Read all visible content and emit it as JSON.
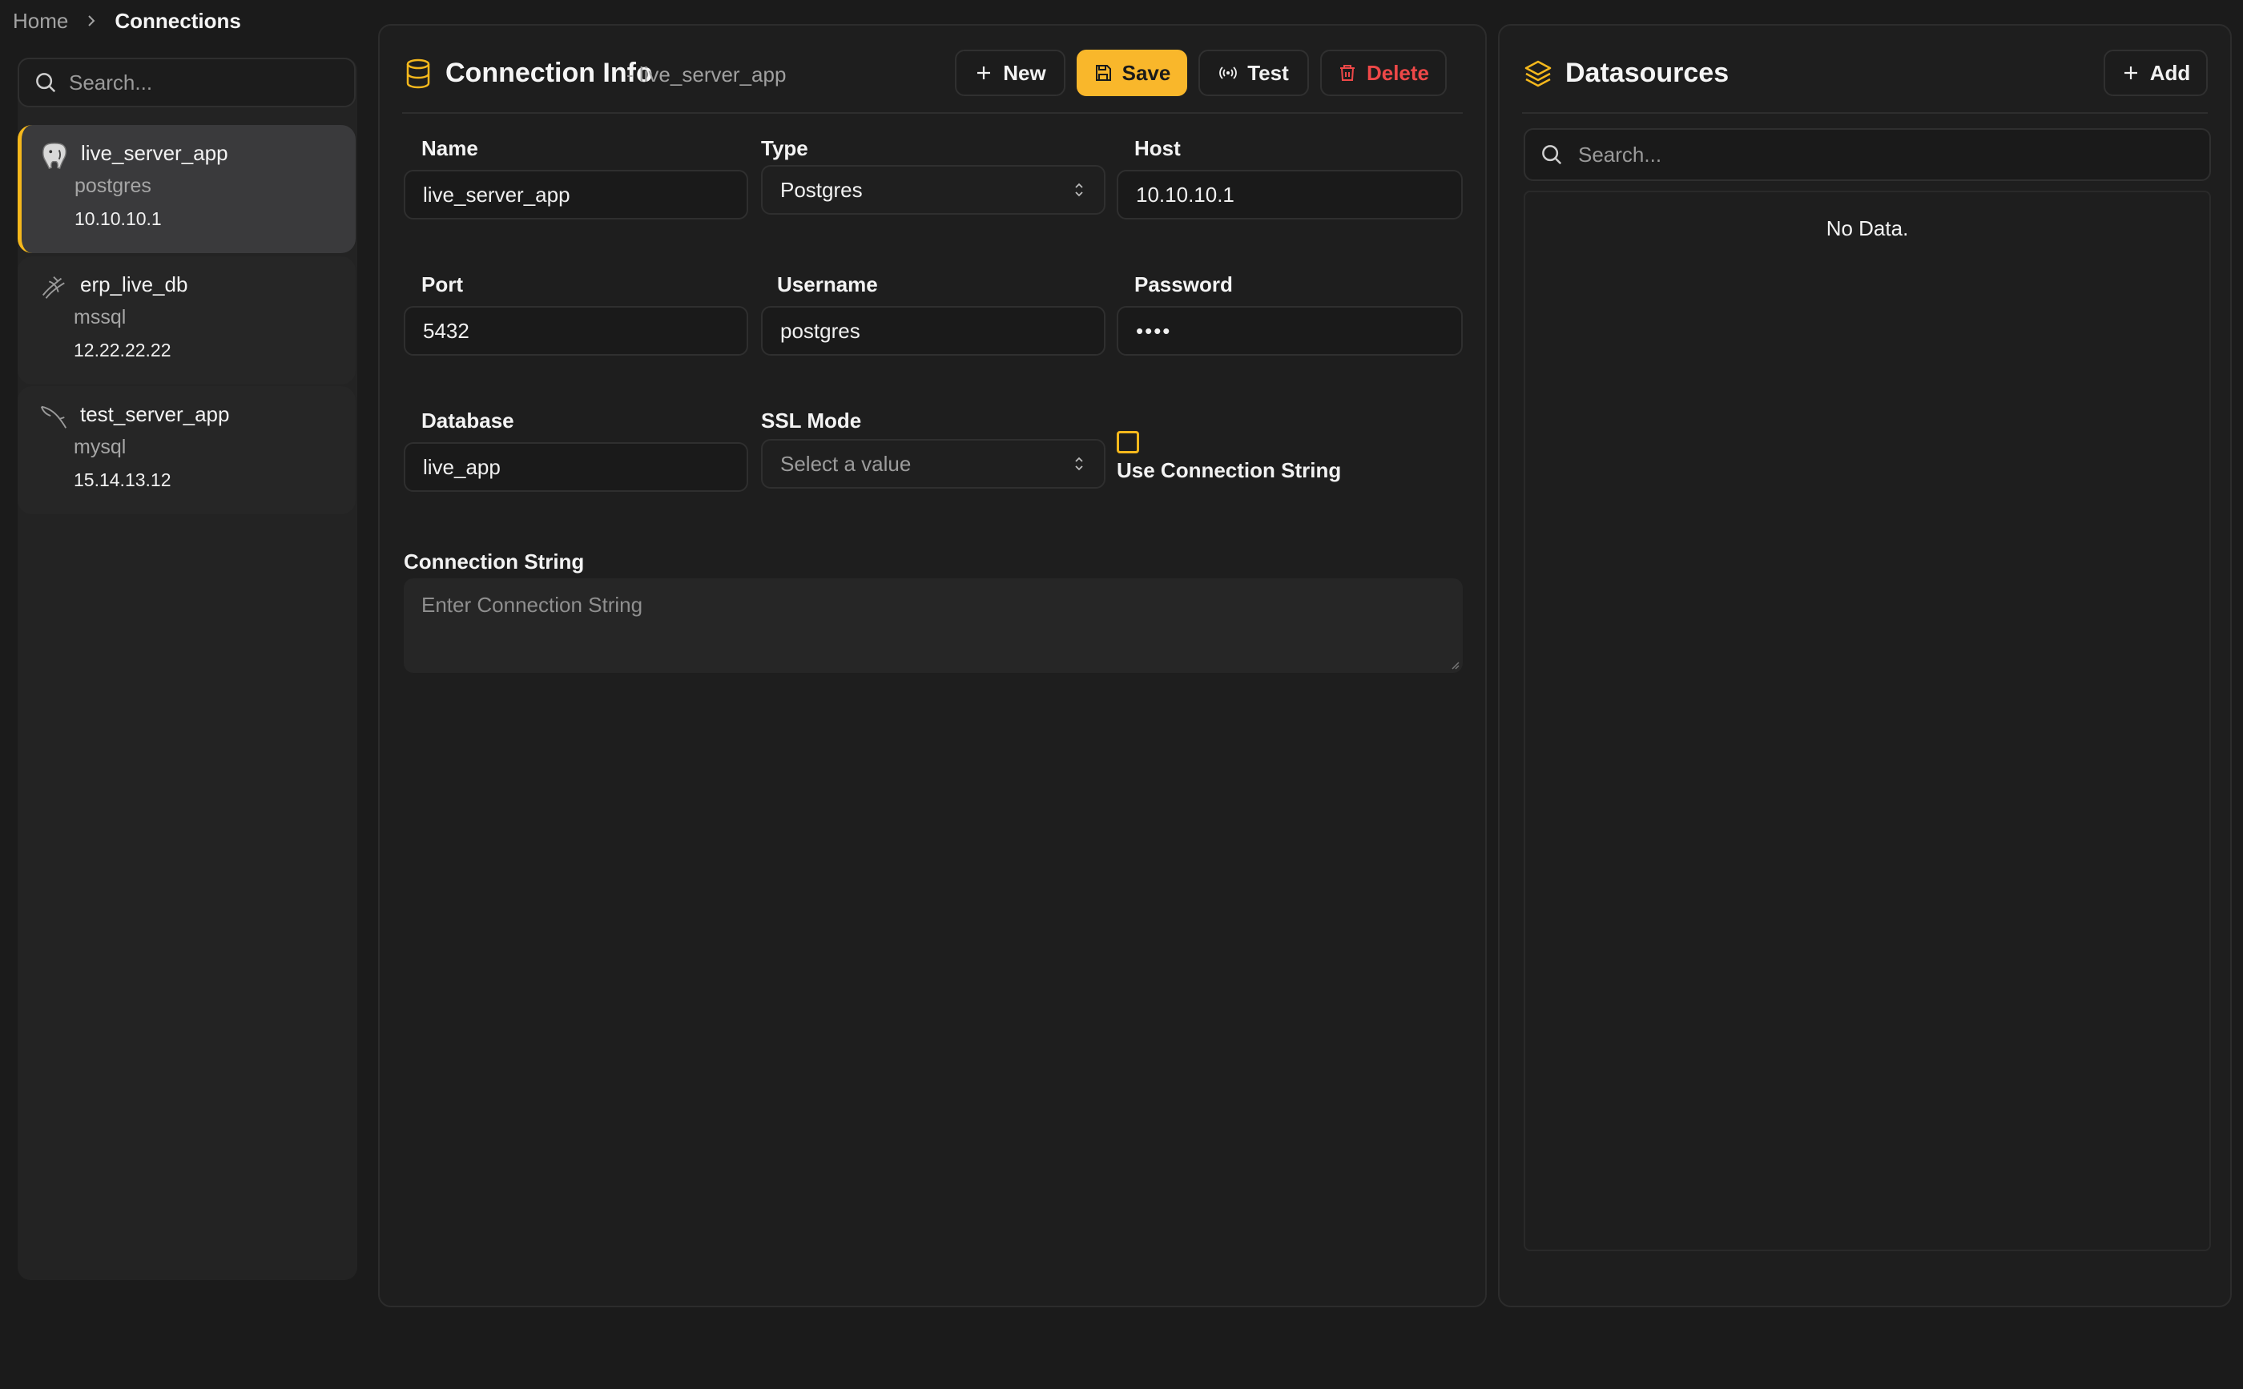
{
  "breadcrumb": {
    "home": "Home",
    "current": "Connections"
  },
  "sidebar": {
    "search_placeholder": "Search...",
    "connections": [
      {
        "name": "live_server_app",
        "type": "postgres",
        "host": "10.10.10.1",
        "icon": "postgres-elephant-icon",
        "active": true
      },
      {
        "name": "erp_live_db",
        "type": "mssql",
        "host": "12.22.22.22",
        "icon": "mssql-icon",
        "active": false
      },
      {
        "name": "test_server_app",
        "type": "mysql",
        "host": "15.14.13.12",
        "icon": "mysql-dolphin-icon",
        "active": false
      }
    ]
  },
  "connection_info": {
    "title": "Connection Info",
    "subtitle": "- live_server_app",
    "buttons": {
      "new": "New",
      "save": "Save",
      "test": "Test",
      "delete": "Delete"
    },
    "fields": {
      "name": {
        "label": "Name",
        "value": "live_server_app"
      },
      "type": {
        "label": "Type",
        "value": "Postgres"
      },
      "host": {
        "label": "Host",
        "value": "10.10.10.1"
      },
      "port": {
        "label": "Port",
        "value": "5432"
      },
      "username": {
        "label": "Username",
        "value": "postgres"
      },
      "password": {
        "label": "Password",
        "value": "••••"
      },
      "database": {
        "label": "Database",
        "value": "live_app"
      },
      "ssl_mode": {
        "label": "SSL Mode",
        "placeholder": "Select a value"
      },
      "use_connection_string": {
        "label": "Use Connection String",
        "checked": false
      },
      "connection_string": {
        "label": "Connection String",
        "placeholder": "Enter Connection String"
      }
    }
  },
  "datasources": {
    "title": "Datasources",
    "add_label": "Add",
    "search_placeholder": "Search...",
    "empty_text": "No Data."
  },
  "colors": {
    "accent": "#f9b72b",
    "danger": "#ee4848",
    "background": "#1b1b1b",
    "panel": "#1e1e1e"
  }
}
